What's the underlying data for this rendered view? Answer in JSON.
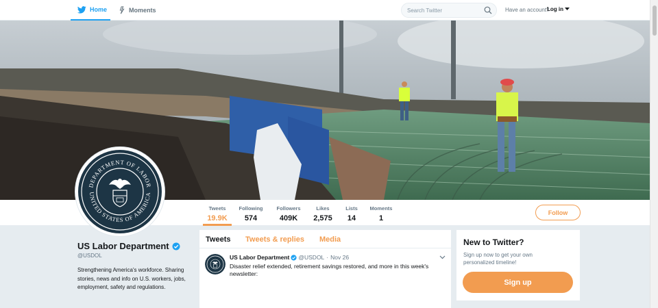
{
  "nav": {
    "home_label": "Home",
    "moments_label": "Moments",
    "search_placeholder": "Search Twitter",
    "have_account": "Have an account?",
    "login_label": "Log in"
  },
  "profile": {
    "name": "US Labor Department",
    "handle": "@USDOL",
    "bio": "Strengthening America's workforce. Sharing stories, news and info on U.S. workers, jobs, employment, safety and regulations.",
    "seal_text_top": "DEPARTMENT OF LABOR",
    "seal_text_bottom": "UNITED STATES OF AMERICA"
  },
  "stats": [
    {
      "label": "Tweets",
      "value": "19.9K"
    },
    {
      "label": "Following",
      "value": "574"
    },
    {
      "label": "Followers",
      "value": "409K"
    },
    {
      "label": "Likes",
      "value": "2,575"
    },
    {
      "label": "Lists",
      "value": "14"
    },
    {
      "label": "Moments",
      "value": "1"
    }
  ],
  "follow_label": "Follow",
  "timeline": {
    "tabs": [
      "Tweets",
      "Tweets & replies",
      "Media"
    ],
    "tweet": {
      "name": "US Labor Department",
      "handle": "@USDOL",
      "separator": "·",
      "date": "Nov 26",
      "text": "Disaster relief extended, retirement savings restored, and more in this week's newsletter:"
    }
  },
  "signup": {
    "title": "New to Twitter?",
    "subtitle": "Sign up now to get your own personalized timeline!",
    "button_label": "Sign up"
  },
  "colors": {
    "accent": "#f29c50",
    "twitter_blue": "#1da1f2",
    "seal_navy": "#1d3545"
  },
  "icons": {
    "home": "bird-icon",
    "moments": "lightning-icon",
    "search": "search-icon",
    "verified": "verified-badge-icon",
    "chevron": "chevron-down-icon"
  }
}
